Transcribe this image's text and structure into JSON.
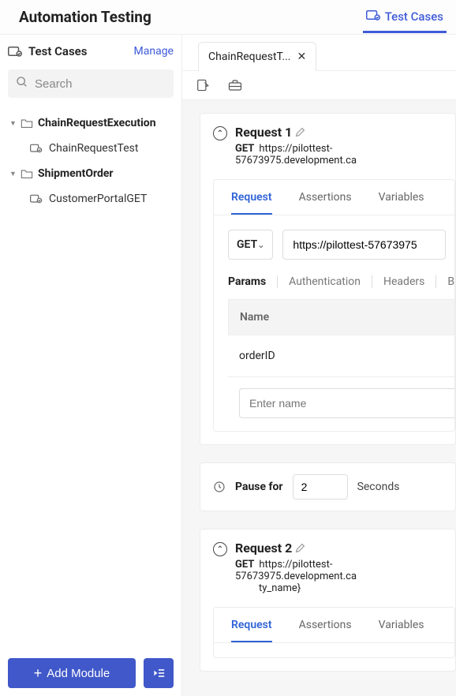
{
  "header": {
    "title": "Automation Testing",
    "testcases_label": "Test Cases"
  },
  "sidebar": {
    "title": "Test Cases",
    "manage_label": "Manage",
    "search_placeholder": "Search",
    "folders": [
      {
        "name": "ChainRequestExecution",
        "items": [
          {
            "name": "ChainRequestTest"
          }
        ]
      },
      {
        "name": "ShipmentOrder",
        "items": [
          {
            "name": "CustomerPortalGET"
          }
        ]
      }
    ],
    "add_module_label": "Add Module"
  },
  "tabs": [
    {
      "label": "ChainRequestT..."
    }
  ],
  "subtabs": {
    "request": "Request",
    "assertions": "Assertions",
    "variables": "Variables"
  },
  "paramtabs": {
    "params": "Params",
    "authentication": "Authentication",
    "headers": "Headers",
    "body": "Bo"
  },
  "method_options": [
    "GET"
  ],
  "param_table": {
    "header_name": "Name",
    "placeholder_name": "Enter name"
  },
  "requests": [
    {
      "title": "Request 1",
      "method": "GET",
      "url_display": "https://pilottest-57673975.development.ca",
      "url_input": "https://pilottest-57673975",
      "params": [
        {
          "name": "orderID"
        }
      ]
    },
    {
      "title": "Request 2",
      "method": "GET",
      "url_display": "https://pilottest-57673975.development.ca",
      "url_display2": "ty_name}",
      "url_input": ""
    }
  ],
  "pause": {
    "label": "Pause for",
    "value": "2",
    "unit": "Seconds"
  }
}
